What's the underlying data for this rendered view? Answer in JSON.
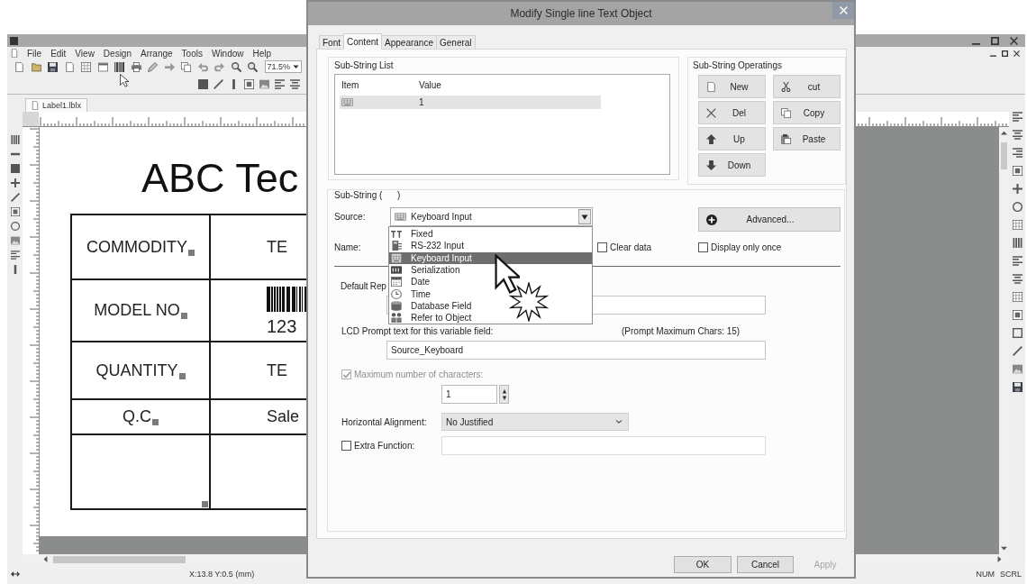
{
  "app": {
    "menu": [
      "File",
      "Edit",
      "View",
      "Design",
      "Arrange",
      "Tools",
      "Window",
      "Help"
    ],
    "zoom": "71.5%",
    "document_tab": "Label1.lblx",
    "label": {
      "title": "ABC Tec",
      "rows": [
        {
          "kind": "text",
          "name": "COMMODITY",
          "value": "TE"
        },
        {
          "kind": "barcode",
          "name": "MODEL NO",
          "value": "123"
        },
        {
          "kind": "text",
          "name": "QUANTITY",
          "value": "TE"
        },
        {
          "kind": "text",
          "name": "Q.C",
          "value": "Sale"
        },
        {
          "kind": "empty"
        }
      ]
    },
    "status_bar": {
      "position": "X:13.8 Y:0.5 (mm)",
      "indicators": [
        "NUM",
        "SCRL"
      ]
    }
  },
  "dialog": {
    "title": "Modify Single line Text Object",
    "tabs": [
      {
        "label": "Font",
        "selected": false
      },
      {
        "label": "Content",
        "selected": true
      },
      {
        "label": "Appearance",
        "selected": false
      },
      {
        "label": "General",
        "selected": false
      }
    ],
    "substring_list": {
      "title": "Sub-String List",
      "columns": [
        "Item",
        "Value"
      ],
      "rows": [
        {
          "value": "1",
          "selected": true
        }
      ]
    },
    "operations": {
      "title": "Sub-String Operatings",
      "buttons": [
        "New",
        "cut",
        "Del",
        "Copy",
        "Up",
        "Paste",
        "Down"
      ]
    },
    "substring": {
      "title": "Sub-String (      )",
      "source": {
        "label": "Source:",
        "value": "Keyboard Input",
        "expanded": true,
        "options": [
          {
            "label": "Fixed",
            "selected": false
          },
          {
            "label": "RS-232 Input",
            "selected": false
          },
          {
            "label": "Keyboard Input",
            "selected": true
          },
          {
            "label": "Serialization",
            "selected": false
          },
          {
            "label": "Date",
            "selected": false
          },
          {
            "label": "Time",
            "selected": false
          },
          {
            "label": "Database Field",
            "selected": false
          },
          {
            "label": "Refer to Object",
            "selected": false
          }
        ]
      },
      "advanced_button": "Advanced...",
      "name_label": "Name:",
      "options": [
        {
          "label": "Clear data",
          "checked": false
        },
        {
          "label": "Display only once",
          "checked": false
        }
      ],
      "default_label": "Default Rep",
      "lcd_prompt": {
        "label": "LCD Prompt text for this variable field:",
        "note": "(Prompt Maximum Chars: 15)",
        "value": "Source_Keyboard"
      },
      "max_chars": {
        "label": "Maximum number of characters:",
        "checked": true,
        "disabled": true,
        "value": "1"
      },
      "alignment": {
        "label": "Horizontal Alignment:",
        "value": "No Justified"
      },
      "extra_function": {
        "label": "Extra Function:",
        "checked": false
      }
    },
    "buttons": [
      {
        "label": "OK",
        "disabled": false
      },
      {
        "label": "Cancel",
        "disabled": false
      },
      {
        "label": "Apply",
        "disabled": true
      }
    ]
  }
}
